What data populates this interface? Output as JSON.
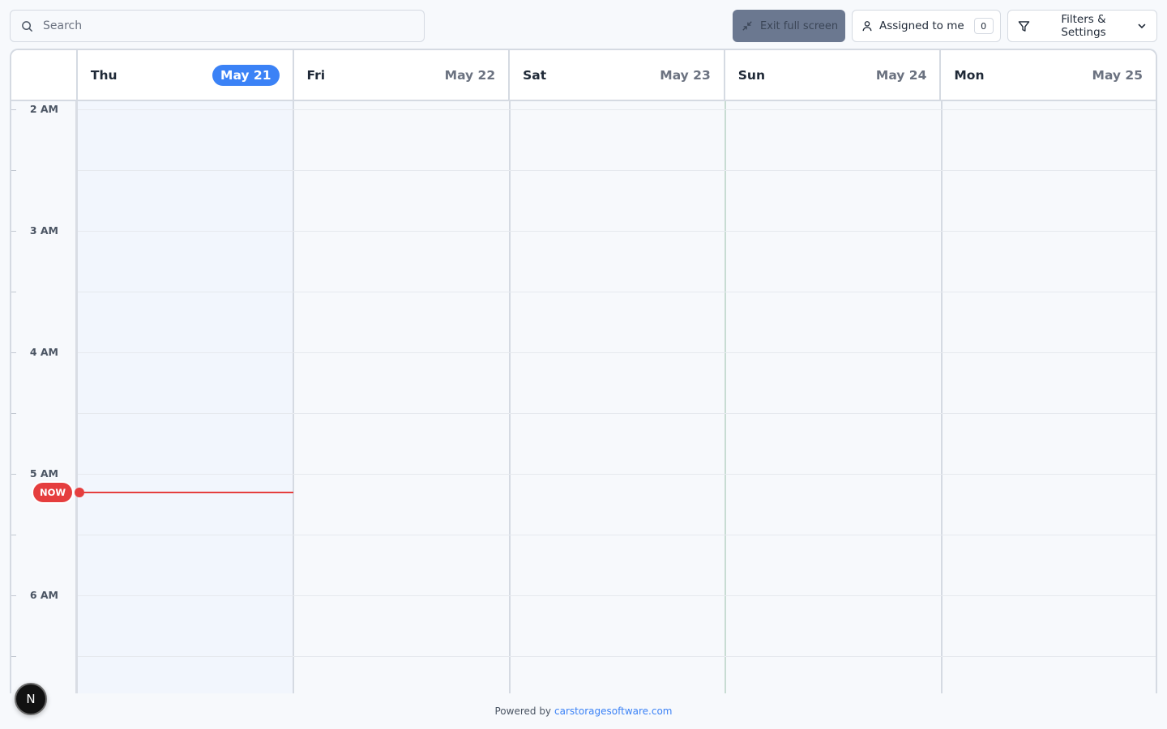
{
  "search": {
    "placeholder": "Search"
  },
  "toolbar": {
    "exit_fullscreen_label": "Exit full screen",
    "assigned_label": "Assigned to me",
    "assigned_count": "0",
    "filters_label": "Filters & Settings"
  },
  "calendar": {
    "days": [
      {
        "name": "Thu",
        "date": "May 21",
        "today": true
      },
      {
        "name": "Fri",
        "date": "May 22",
        "today": false
      },
      {
        "name": "Sat",
        "date": "May 23",
        "today": false
      },
      {
        "name": "Sun",
        "date": "May 24",
        "today": false
      },
      {
        "name": "Mon",
        "date": "May 25",
        "today": false
      }
    ],
    "hours": [
      "2 AM",
      "3 AM",
      "4 AM",
      "5 AM",
      "6 AM"
    ],
    "now_label": "NOW"
  },
  "footer": {
    "powered_by": "Powered by",
    "link_text": "carstoragesoftware.com"
  },
  "avatar": {
    "initial": "N"
  },
  "colors": {
    "accent": "#3b82f6",
    "now": "#e53e3e",
    "exit_button_bg": "#6b7890"
  },
  "icons": {
    "search": "search-icon",
    "exit": "minimize-icon",
    "user": "user-icon",
    "filter": "filter-icon",
    "chevron": "chevron-down-icon"
  }
}
